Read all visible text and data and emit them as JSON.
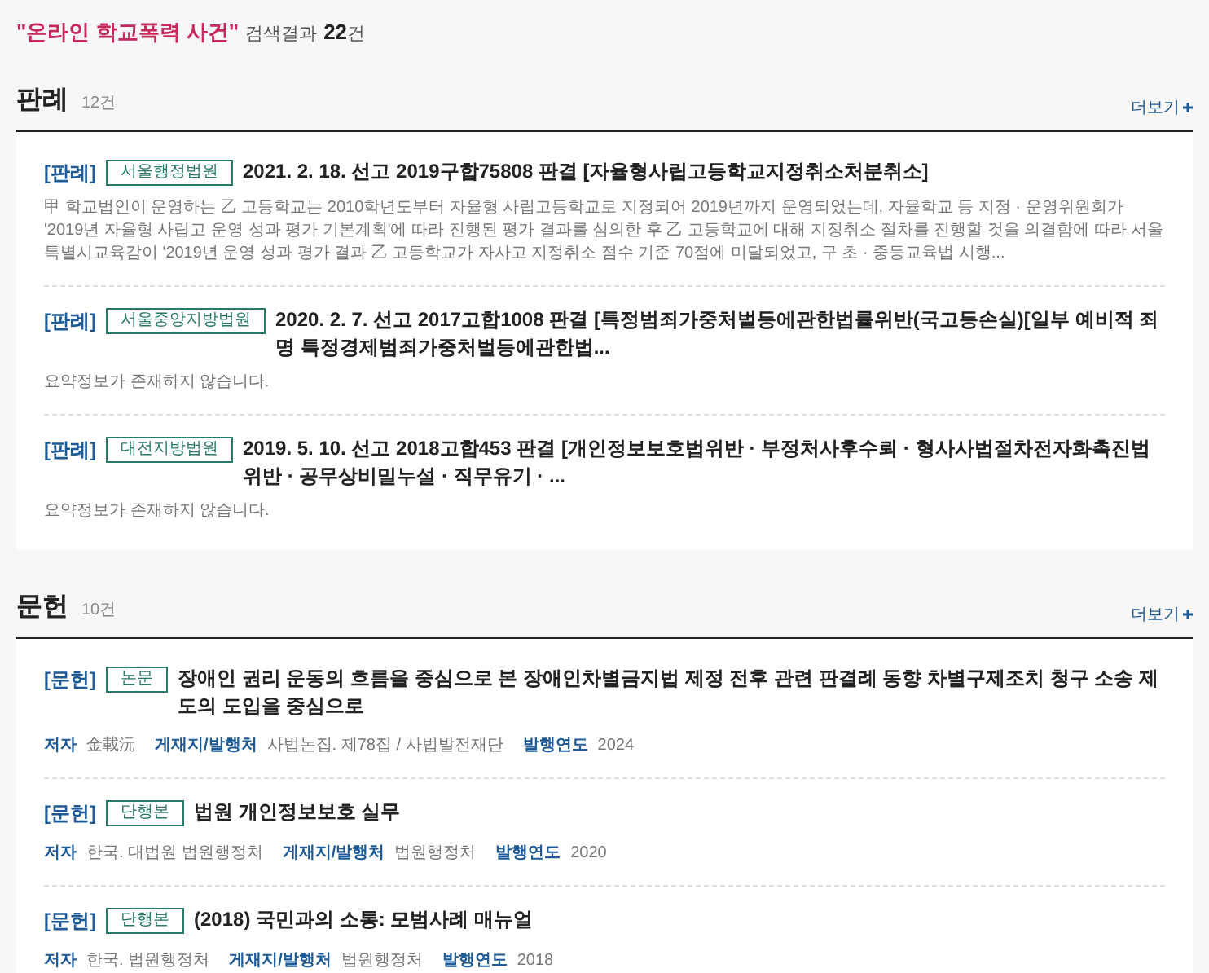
{
  "search_summary": {
    "query": "\"온라인 학교폭력 사건\"",
    "label": "검색결과",
    "count": "22",
    "unit": "건"
  },
  "sections": [
    {
      "title": "판례",
      "count": "12건",
      "more": "더보기",
      "items": [
        {
          "kind": "case",
          "category": "[판례]",
          "badge": "서울행정법원",
          "title": "2021. 2. 18. 선고 2019구합75808 판결 [자율형사립고등학교지정취소처분취소]",
          "summary": "甲 학교법인이 운영하는 乙 고등학교는 2010학년도부터 자율형 사립고등학교로 지정되어 2019년까지 운영되었는데, 자율학교 등 지정 · 운영위원회가 '2019년 자율형 사립고 운영 성과 평가 기본계획'에 따라 진행된 평가 결과를 심의한 후 乙 고등학교에 대해 지정취소 절차를 진행할 것을 의결함에 따라 서울특별시교육감이 '2019년 운영 성과 평가 결과 乙 고등학교가 자사고 지정취소 점수 기준 70점에 미달되었고, 구 초 · 중등교육법 시행..."
        },
        {
          "kind": "case",
          "category": "[판례]",
          "badge": "서울중앙지방법원",
          "title": "2020. 2. 7. 선고 2017고합1008 판결 [특정범죄가중처벌등에관한법률위반(국고등손실)[일부 예비적 죄명 특정경제범죄가중처벌등에관한법...",
          "summary": "요약정보가 존재하지 않습니다."
        },
        {
          "kind": "case",
          "category": "[판례]",
          "badge": "대전지방법원",
          "title": "2019. 5. 10. 선고 2018고합453 판결 [개인정보보호법위반 · 부정처사후수뢰 · 형사사법절차전자화촉진법위반 · 공무상비밀누설 · 직무유기 · ...",
          "summary": "요약정보가 존재하지 않습니다."
        }
      ]
    },
    {
      "title": "문헌",
      "count": "10건",
      "more": "더보기",
      "items": [
        {
          "kind": "literature",
          "category": "[문헌]",
          "badge": "논문",
          "title": "장애인 권리 운동의 흐름을 중심으로 본 장애인차별금지법 제정 전후 관련 판결례 동향 차별구제조치 청구 소송 제도의 도입을 중심으로",
          "meta": [
            {
              "label": "저자",
              "value": "金載沅"
            },
            {
              "label": "게재지/발행처",
              "value": "사법논집. 제78집 / 사법발전재단"
            },
            {
              "label": "발행연도",
              "value": "2024"
            }
          ]
        },
        {
          "kind": "literature",
          "category": "[문헌]",
          "badge": "단행본",
          "title": "법원 개인정보보호 실무",
          "meta": [
            {
              "label": "저자",
              "value": "한국. 대법원 법원행정처"
            },
            {
              "label": "게재지/발행처",
              "value": "법원행정처"
            },
            {
              "label": "발행연도",
              "value": "2020"
            }
          ]
        },
        {
          "kind": "literature",
          "category": "[문헌]",
          "badge": "단행본",
          "title": "(2018) 국민과의 소통: 모범사례 매뉴얼",
          "meta": [
            {
              "label": "저자",
              "value": "한국. 법원행정처"
            },
            {
              "label": "게재지/발행처",
              "value": "법원행정처"
            },
            {
              "label": "발행연도",
              "value": "2018"
            }
          ]
        }
      ]
    }
  ]
}
